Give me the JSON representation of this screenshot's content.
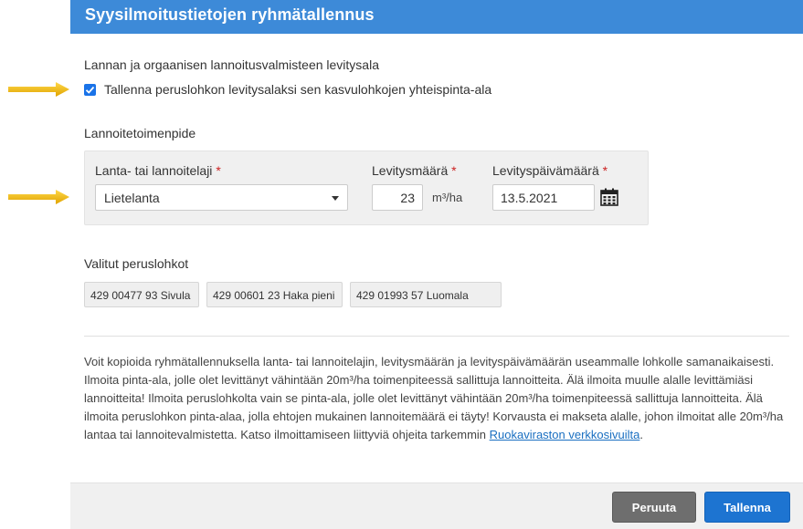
{
  "dialog": {
    "title": "Syysilmoitustietojen ryhmätallennus"
  },
  "spreading_area": {
    "heading": "Lannan ja orgaanisen lannoitusvalmisteen levitysala",
    "checkbox_label": "Tallenna peruslohkon levitysalaksi sen kasvulohkojen yhteispinta-ala",
    "checked": true
  },
  "operation": {
    "heading": "Lannoitetoimenpide",
    "type_label": "Lanta- tai lannoitelaji",
    "type_value": "Lietelanta",
    "amount_label": "Levitysmäärä",
    "amount_value": "23",
    "amount_unit": "m³/ha",
    "date_label": "Levityspäivämäärä",
    "date_value": "13.5.2021",
    "required_marker": "*"
  },
  "selected": {
    "heading": "Valitut peruslohkot",
    "blocks": [
      "429 00477 93 Sivula",
      "429 00601 23 Haka pieni",
      "429 01993 57 Luomala"
    ]
  },
  "info": {
    "text": "Voit kopioida ryhmätallennuksella lanta- tai lannoitelajin, levitysmäärän ja levityspäivämäärän useammalle lohkolle samanaikaisesti. Ilmoita pinta-ala, jolle olet levittänyt vähintään 20m³/ha toimenpiteessä sallittuja lannoitteita. Älä ilmoita muulle alalle levittämiäsi lannoitteita! Ilmoita peruslohkolta vain se pinta-ala, jolle olet levittänyt vähintään 20m³/ha toimenpiteessä sallittuja lannoitteita. Älä ilmoita peruslohkon pinta-alaa, jolla ehtojen mukainen lannoitemäärä ei täyty! Korvausta ei makseta alalle, johon ilmoitat alle 20m³/ha lantaa tai lannoitevalmistetta. Katso ilmoittamiseen liittyviä ohjeita tarkemmin ",
    "link_text": "Ruokaviraston verkkosivuilta",
    "suffix": "."
  },
  "buttons": {
    "cancel": "Peruuta",
    "save": "Tallenna"
  },
  "icons": {
    "annotation": "arrow-right-icon",
    "calendar": "calendar-icon",
    "dropdown": "chevron-down-icon",
    "check": "checkmark-icon"
  },
  "colors": {
    "header": "#3d8ad8",
    "accent": "#1d74d1",
    "arrow": "#f2b400",
    "required": "#cc2222"
  }
}
